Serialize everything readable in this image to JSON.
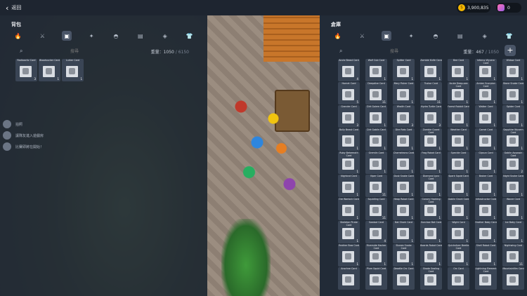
{
  "topbar": {
    "back_label": "返回",
    "coins": "3,900,835",
    "gems": "0"
  },
  "backpack": {
    "title": "背包",
    "search_placeholder": "搜尋",
    "capacity_label": "重量：",
    "capacity_used": "1050",
    "capacity_max": "/ 6150",
    "items": [
      {
        "name": "Radioactiv Card",
        "count": "3"
      },
      {
        "name": "Bloodsucker Card",
        "count": "1"
      },
      {
        "name": "Lurker Card",
        "count": "1"
      }
    ]
  },
  "warehouse": {
    "title": "倉庫",
    "search_placeholder": "搜尋",
    "capacity_label": "重量：",
    "capacity_used": "467",
    "capacity_max": "/ 1050",
    "items": [
      {
        "name": "Acute Beast Card",
        "count": "4"
      },
      {
        "name": "Wolf Cub Card",
        "count": "1"
      },
      {
        "name": "Spitter Card",
        "count": "1"
      },
      {
        "name": "Zombie Knife Card",
        "count": "1"
      },
      {
        "name": "Bee Card",
        "count": "1"
      },
      {
        "name": "Inferno Wyvern Card",
        "count": "1"
      },
      {
        "name": "Widow Card",
        "count": "1"
      },
      {
        "name": "",
        "count": ""
      },
      {
        "name": "Hornet Card",
        "count": "5"
      },
      {
        "name": "Deepdive Card",
        "count": "11"
      },
      {
        "name": "Mary Fisher Card",
        "count": "1"
      },
      {
        "name": "Tuskor Card",
        "count": "11"
      },
      {
        "name": "Acute Deep-sea Card",
        "count": "1"
      },
      {
        "name": "Amber Scorpion Card",
        "count": "1"
      },
      {
        "name": "Stone Snake Card",
        "count": "1"
      },
      {
        "name": "",
        "count": ""
      },
      {
        "name": "Grander Card",
        "count": "3"
      },
      {
        "name": "Dirt Golem Card",
        "count": "1"
      },
      {
        "name": "Wraith Card",
        "count": "3"
      },
      {
        "name": "Hydra Turtle Card",
        "count": "3"
      },
      {
        "name": "Forest Rabbit Card",
        "count": "1"
      },
      {
        "name": "Walker Card",
        "count": "1"
      },
      {
        "name": "Spider Card",
        "count": "1"
      },
      {
        "name": "",
        "count": ""
      },
      {
        "name": "Bully Beast Card",
        "count": "1"
      },
      {
        "name": "Dirt Goblin Card",
        "count": "1"
      },
      {
        "name": "Dire Rats Card",
        "count": "1"
      },
      {
        "name": "Zombie Guard Card",
        "count": "1"
      },
      {
        "name": "Weather Card",
        "count": "1"
      },
      {
        "name": "Camel Card",
        "count": "1"
      },
      {
        "name": "Sapphire Wyvern Card",
        "count": "1"
      },
      {
        "name": "",
        "count": ""
      },
      {
        "name": "Ruby Behemoth Card",
        "count": "1"
      },
      {
        "name": "Gremlin Card",
        "count": "1"
      },
      {
        "name": "Chameleons Card",
        "count": "1"
      },
      {
        "name": "Frog Robot Card",
        "count": "1"
      },
      {
        "name": "Speckle Card",
        "count": "1"
      },
      {
        "name": "Gipsun Card",
        "count": "1"
      },
      {
        "name": "Goblin Assassin Card",
        "count": "2"
      },
      {
        "name": "",
        "count": ""
      },
      {
        "name": "Nightcat Card",
        "count": "1"
      },
      {
        "name": "Viper Card",
        "count": "11"
      },
      {
        "name": "Dusk Snake Card",
        "count": "1"
      },
      {
        "name": "Diamond Lynx Card",
        "count": "1"
      },
      {
        "name": "Spark Squid Card",
        "count": "1"
      },
      {
        "name": "Broker Card",
        "count": "1"
      },
      {
        "name": "Night Snake Card",
        "count": "1"
      },
      {
        "name": "",
        "count": ""
      },
      {
        "name": "Ore Warlock Card",
        "count": "1"
      },
      {
        "name": "Squidling Card",
        "count": "11"
      },
      {
        "name": "Heap Robot Card",
        "count": "1"
      },
      {
        "name": "Canary Hacking Card",
        "count": "1"
      },
      {
        "name": "Goblin Grunt Card",
        "count": "1"
      },
      {
        "name": "Infrastructor Card",
        "count": "1"
      },
      {
        "name": "Wavre Card",
        "count": "1"
      },
      {
        "name": "",
        "count": ""
      },
      {
        "name": "Skeleton Pirate Card",
        "count": "1"
      },
      {
        "name": "Sawbot Card",
        "count": "4"
      },
      {
        "name": "Bat Shark Card",
        "count": "1"
      },
      {
        "name": "Sunclaw Bat Card",
        "count": "1"
      },
      {
        "name": "Wight Card",
        "count": "1"
      },
      {
        "name": "Feather Baby Card",
        "count": "1"
      },
      {
        "name": "Ice Baby Card",
        "count": "1"
      },
      {
        "name": "",
        "count": ""
      },
      {
        "name": "Feather Bow Card",
        "count": "1"
      },
      {
        "name": "Riverside Hacker Card",
        "count": "1"
      },
      {
        "name": "Stones Snake Card",
        "count": "1"
      },
      {
        "name": "Boards Robot Card",
        "count": "1"
      },
      {
        "name": "Quicksilver Beetle Card",
        "count": "1"
      },
      {
        "name": "Shell Robot Card",
        "count": "1"
      },
      {
        "name": "Nightwing Card",
        "count": "11"
      },
      {
        "name": "",
        "count": ""
      },
      {
        "name": "Arachne Card",
        "count": ""
      },
      {
        "name": "Plum Squid Card",
        "count": ""
      },
      {
        "name": "Deadlie Orc Card",
        "count": ""
      },
      {
        "name": "Shade Sealing Card",
        "count": ""
      },
      {
        "name": "Orc Card",
        "count": ""
      },
      {
        "name": "Lightning Element Card",
        "count": ""
      },
      {
        "name": "Mountainfilm Card",
        "count": ""
      },
      {
        "name": "",
        "count": ""
      }
    ]
  },
  "chat": [
    {
      "text": "拍照"
    },
    {
      "text": "讓隊友進入遊戲房"
    },
    {
      "text": "比賽即將在開始！"
    }
  ],
  "tabs": [
    {
      "icon": "fire-icon",
      "glyph": "🔥"
    },
    {
      "icon": "sword-icon",
      "glyph": "⚔"
    },
    {
      "icon": "card-icon",
      "glyph": "▣"
    },
    {
      "icon": "crosshair-icon",
      "glyph": "✦"
    },
    {
      "icon": "helmet-icon",
      "glyph": "◓"
    },
    {
      "icon": "book-icon",
      "glyph": "▤"
    },
    {
      "icon": "eraser-icon",
      "glyph": "◈"
    },
    {
      "icon": "shirt-icon",
      "glyph": "👕"
    }
  ]
}
